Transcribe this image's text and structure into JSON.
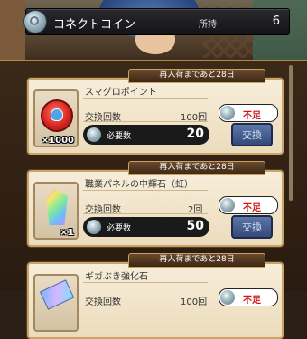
{
  "header": {
    "title": "コネクトコイン",
    "own_label": "所持",
    "own_count": "6",
    "coin_icon": "connect-coin-icon"
  },
  "items": [
    {
      "restock_label": "再入荷まであと28日",
      "name": "スマグロポイント",
      "quantity": "×1000",
      "exchange_count_label": "交換回数",
      "exchange_count": "100回",
      "required_label": "必要数",
      "required": "20",
      "status": "不足",
      "button_label": "交換",
      "icon": "smaglo-point-token-icon"
    },
    {
      "restock_label": "再入荷まであと28日",
      "name": "職業パネルの中輝石（虹）",
      "quantity": "×1",
      "exchange_count_label": "交換回数",
      "exchange_count": "2回",
      "required_label": "必要数",
      "required": "50",
      "status": "不足",
      "button_label": "交換",
      "icon": "rainbow-crystal-icon"
    },
    {
      "restock_label": "再入荷まであと28日",
      "name": "ギガぶき強化石",
      "exchange_count_label": "交換回数",
      "exchange_count": "100回",
      "status": "不足",
      "icon": "giga-weapon-stone-icon"
    }
  ],
  "colors": {
    "status_red": "#d21414",
    "button_blue": "#35497a",
    "card_bg": "#f3e6cd",
    "frame_gold": "#c8a468"
  }
}
